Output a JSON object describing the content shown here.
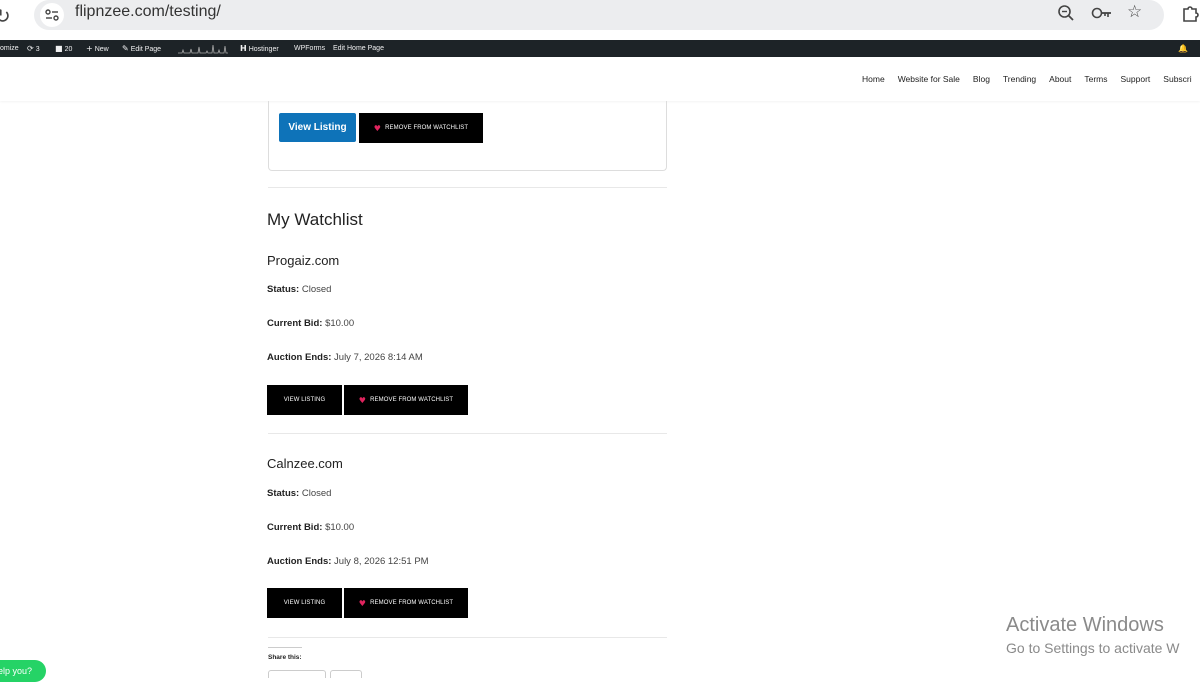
{
  "browser": {
    "url": "flipnzee.com/testing/"
  },
  "wp_admin_bar": {
    "customize": "omize",
    "updates": "3",
    "comments": "20",
    "new": "New",
    "edit_page": "Edit Page",
    "hostinger": "Hostinger",
    "wpforms": "WPForms",
    "edit_home": "Edit Home Page"
  },
  "nav": {
    "items": [
      "Home",
      "Website for Sale",
      "Blog",
      "Trending",
      "About",
      "Terms",
      "Support",
      "Subscri"
    ]
  },
  "top_card": {
    "view_label": "View Listing",
    "remove_label": "REMOVE FROM WATCHLIST"
  },
  "watchlist": {
    "heading": "My Watchlist",
    "items": [
      {
        "title": "Progaiz.com",
        "status_label": "Status:",
        "status": "Closed",
        "bid_label": "Current Bid:",
        "bid": "$10.00",
        "ends_label": "Auction Ends:",
        "ends": "July 7, 2026 8:14 AM",
        "view_label": "VIEW LISTING",
        "remove_label": "REMOVE FROM WATCHLIST"
      },
      {
        "title": "Calnzee.com",
        "status_label": "Status:",
        "status": "Closed",
        "bid_label": "Current Bid:",
        "bid": "$10.00",
        "ends_label": "Auction Ends:",
        "ends": "July 8, 2026 12:51 PM",
        "view_label": "VIEW LISTING",
        "remove_label": "REMOVE FROM WATCHLIST"
      }
    ]
  },
  "share": {
    "label": "Share this:"
  },
  "help_chat": {
    "label": "elp you?"
  },
  "windows_watermark": {
    "line1": "Activate Windows",
    "line2": "Go to Settings to activate W"
  }
}
